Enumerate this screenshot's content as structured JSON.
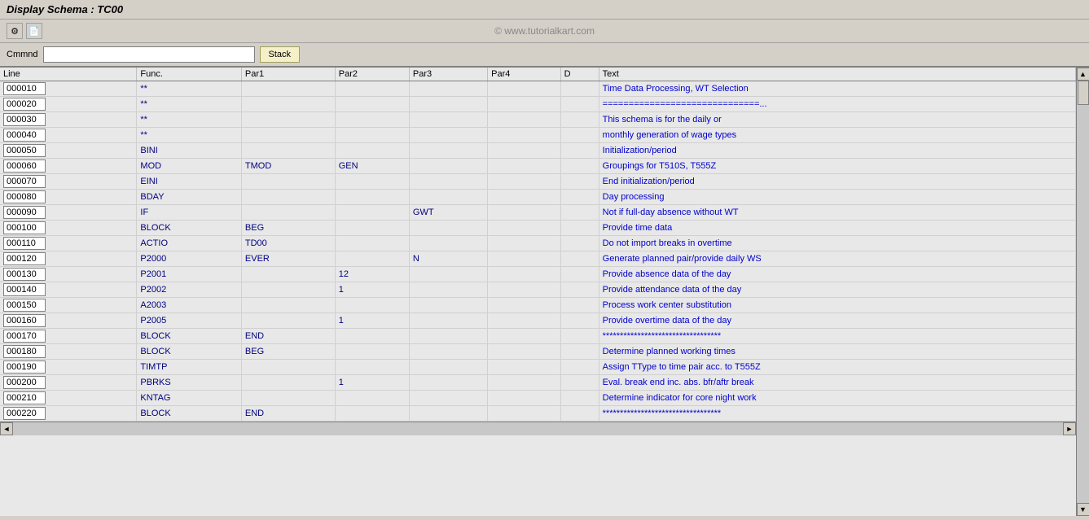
{
  "titleBar": {
    "label": "Display Schema : TC00"
  },
  "toolbar": {
    "watermark": "© www.tutorialkart.com",
    "icons": [
      {
        "name": "settings-icon",
        "symbol": "⚙"
      },
      {
        "name": "save-icon",
        "symbol": "💾"
      }
    ]
  },
  "commandBar": {
    "label": "Cmmnd",
    "inputValue": "",
    "inputPlaceholder": "",
    "stackButton": "Stack"
  },
  "tableHeaders": {
    "line": "Line",
    "func": "Func.",
    "par1": "Par1",
    "par2": "Par2",
    "par3": "Par3",
    "par4": "Par4",
    "d": "D",
    "text": "Text"
  },
  "rows": [
    {
      "line": "000010",
      "func": "**",
      "par1": "",
      "par2": "",
      "par3": "",
      "par4": "",
      "d": "",
      "text": "Time Data Processing, WT Selection",
      "textType": "link"
    },
    {
      "line": "000020",
      "func": "**",
      "par1": "",
      "par2": "",
      "par3": "",
      "par4": "",
      "d": "",
      "text": "==============================...",
      "textType": "link"
    },
    {
      "line": "000030",
      "func": "**",
      "par1": "",
      "par2": "",
      "par3": "",
      "par4": "",
      "d": "",
      "text": "This schema is for the daily or",
      "textType": "link"
    },
    {
      "line": "000040",
      "func": "**",
      "par1": "",
      "par2": "",
      "par3": "",
      "par4": "",
      "d": "",
      "text": "monthly generation of wage types",
      "textType": "link"
    },
    {
      "line": "000050",
      "func": "BINI",
      "par1": "",
      "par2": "",
      "par3": "",
      "par4": "",
      "d": "",
      "text": "Initialization/period",
      "textType": "link"
    },
    {
      "line": "000060",
      "func": "MOD",
      "par1": "TMOD",
      "par2": "GEN",
      "par3": "",
      "par4": "",
      "d": "",
      "text": "Groupings for T510S, T555Z",
      "textType": "link"
    },
    {
      "line": "000070",
      "func": "EINI",
      "par1": "",
      "par2": "",
      "par3": "",
      "par4": "",
      "d": "",
      "text": "End initialization/period",
      "textType": "link"
    },
    {
      "line": "000080",
      "func": "BDAY",
      "par1": "",
      "par2": "",
      "par3": "",
      "par4": "",
      "d": "",
      "text": "Day processing",
      "textType": "link"
    },
    {
      "line": "000090",
      "func": "IF",
      "par1": "",
      "par2": "",
      "par3": "GWT",
      "par4": "",
      "d": "",
      "text": "Not if full-day absence without WT",
      "textType": "link"
    },
    {
      "line": "000100",
      "func": "BLOCK",
      "par1": "BEG",
      "par2": "",
      "par3": "",
      "par4": "",
      "d": "",
      "text": "Provide time data",
      "textType": "link"
    },
    {
      "line": "000110",
      "func": "ACTIO",
      "par1": "TD00",
      "par2": "",
      "par3": "",
      "par4": "",
      "d": "",
      "text": "Do not import breaks in overtime",
      "textType": "link"
    },
    {
      "line": "000120",
      "func": "P2000",
      "par1": "EVER",
      "par2": "",
      "par3": "N",
      "par4": "",
      "d": "",
      "text": "Generate planned pair/provide daily WS",
      "textType": "link"
    },
    {
      "line": "000130",
      "func": "P2001",
      "par1": "",
      "par2": "12",
      "par3": "",
      "par4": "",
      "d": "",
      "text": "Provide absence data of the day",
      "textType": "link"
    },
    {
      "line": "000140",
      "func": "P2002",
      "par1": "",
      "par2": "1",
      "par3": "",
      "par4": "",
      "d": "",
      "text": "Provide attendance data of the day",
      "textType": "link"
    },
    {
      "line": "000150",
      "func": "A2003",
      "par1": "",
      "par2": "",
      "par3": "",
      "par4": "",
      "d": "",
      "text": "Process work center substitution",
      "textType": "link"
    },
    {
      "line": "000160",
      "func": "P2005",
      "par1": "",
      "par2": "1",
      "par3": "",
      "par4": "",
      "d": "",
      "text": "Provide overtime data of the day",
      "textType": "link"
    },
    {
      "line": "000170",
      "func": "BLOCK",
      "par1": "END",
      "par2": "",
      "par3": "",
      "par4": "",
      "d": "",
      "text": "**********************************",
      "textType": "link"
    },
    {
      "line": "000180",
      "func": "BLOCK",
      "par1": "BEG",
      "par2": "",
      "par3": "",
      "par4": "",
      "d": "",
      "text": "Determine planned working times",
      "textType": "link"
    },
    {
      "line": "000190",
      "func": "TIMTP",
      "par1": "",
      "par2": "",
      "par3": "",
      "par4": "",
      "d": "",
      "text": "Assign TType to time pair acc. to T555Z",
      "textType": "link"
    },
    {
      "line": "000200",
      "func": "PBRKS",
      "par1": "",
      "par2": "1",
      "par3": "",
      "par4": "",
      "d": "",
      "text": "Eval. break end inc. abs. bfr/aftr break",
      "textType": "link"
    },
    {
      "line": "000210",
      "func": "KNTAG",
      "par1": "",
      "par2": "",
      "par3": "",
      "par4": "",
      "d": "",
      "text": "Determine indicator for core night work",
      "textType": "link"
    },
    {
      "line": "000220",
      "func": "BLOCK",
      "par1": "END",
      "par2": "",
      "par3": "",
      "par4": "",
      "d": "",
      "text": "**********************************",
      "textType": "link"
    }
  ]
}
